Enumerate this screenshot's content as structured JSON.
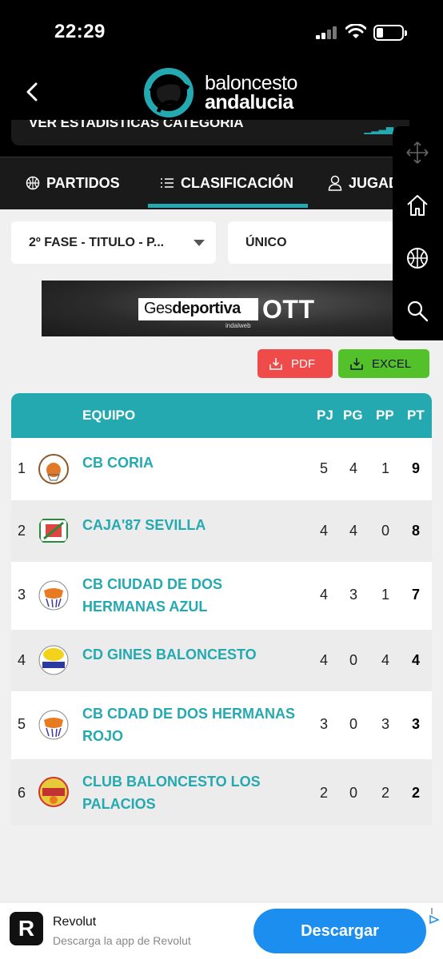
{
  "status_bar": {
    "time": "22:29"
  },
  "brand": {
    "line1": "baloncesto",
    "line2": "andalucia"
  },
  "stat_card": {
    "label": "VER ESTADÍSTICAS CATEGORÍA"
  },
  "tabs": [
    {
      "label": "PARTIDOS",
      "icon": "basketball-icon"
    },
    {
      "label": "CLASIFICACIÓN",
      "icon": "list-icon",
      "active": true
    },
    {
      "label": "JUGAD",
      "icon": "user-icon"
    }
  ],
  "filters": {
    "phase": "2º FASE - TITULO - P...",
    "group": "ÚNICO"
  },
  "banner": {
    "brand_a": "Ges",
    "brand_b": "deportiva",
    "ott": "OTT",
    "sub": "indalweb"
  },
  "export": {
    "pdf": "PDF",
    "excel": "EXCEL"
  },
  "table": {
    "headers": {
      "team": "EQUIPO",
      "pj": "PJ",
      "pg": "PG",
      "pp": "PP",
      "pt": "PT"
    },
    "rows": [
      {
        "pos": "1",
        "team": "CB CORIA",
        "pj": "5",
        "pg": "4",
        "pp": "1",
        "pt": "9"
      },
      {
        "pos": "2",
        "team": "CAJA'87 SEVILLA",
        "pj": "4",
        "pg": "4",
        "pp": "0",
        "pt": "8"
      },
      {
        "pos": "3",
        "team": "CB CIUDAD DE DOS HERMANAS AZUL",
        "pj": "4",
        "pg": "3",
        "pp": "1",
        "pt": "7"
      },
      {
        "pos": "4",
        "team": "CD GINES BALONCESTO",
        "pj": "4",
        "pg": "0",
        "pp": "4",
        "pt": "4"
      },
      {
        "pos": "5",
        "team": "CB CDAD DE DOS HERMANAS ROJO",
        "pj": "3",
        "pg": "0",
        "pp": "3",
        "pt": "3"
      },
      {
        "pos": "6",
        "team": "CLUB BALONCESTO LOS PALACIOS",
        "pj": "2",
        "pg": "0",
        "pp": "2",
        "pt": "2"
      }
    ]
  },
  "ad": {
    "title": "Revolut",
    "subtitle": "Descarga la app de Revolut",
    "cta": "Descargar",
    "logo_letter": "R"
  },
  "colors": {
    "accent": "#25a9b0",
    "pdf": "#ef4b4b",
    "excel": "#53c22a",
    "cta": "#1b8ef0"
  }
}
